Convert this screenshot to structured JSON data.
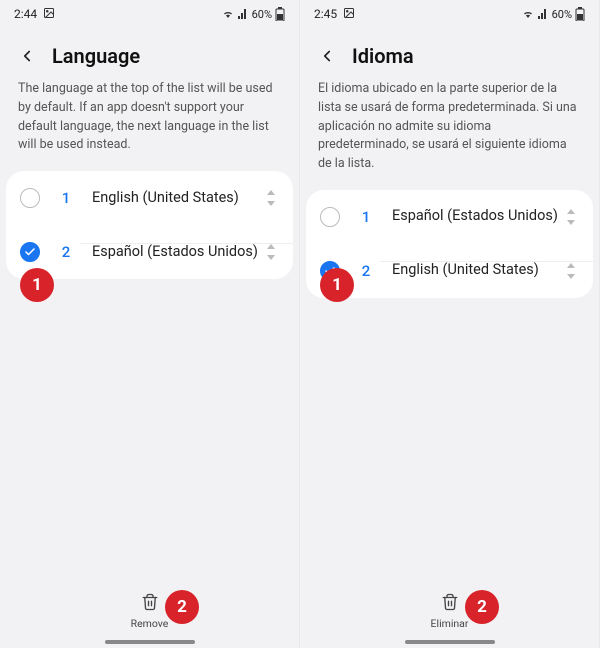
{
  "left": {
    "status": {
      "time": "2:44",
      "battery": "60%"
    },
    "title": "Language",
    "description": "The language at the top of the list will be used by default. If an app doesn't support your default language, the next language in the list will be used instead.",
    "items": [
      {
        "index": "1",
        "label": "English (United States)",
        "checked": false
      },
      {
        "index": "2",
        "label": "Español (Estados Unidos)",
        "checked": true
      }
    ],
    "remove": "Remove",
    "callouts": {
      "c1": "1",
      "c2": "2"
    }
  },
  "right": {
    "status": {
      "time": "2:45",
      "battery": "60%"
    },
    "title": "Idioma",
    "description": "El idioma ubicado en la parte superior de la lista se usará de forma predeterminada. Si una aplicación no admite su idioma predeterminado, se usará el siguiente idioma de la lista.",
    "items": [
      {
        "index": "1",
        "label": "Español (Estados Unidos)",
        "checked": false
      },
      {
        "index": "2",
        "label": "English (United States)",
        "checked": true
      }
    ],
    "remove": "Eliminar",
    "callouts": {
      "c1": "1",
      "c2": "2"
    }
  }
}
